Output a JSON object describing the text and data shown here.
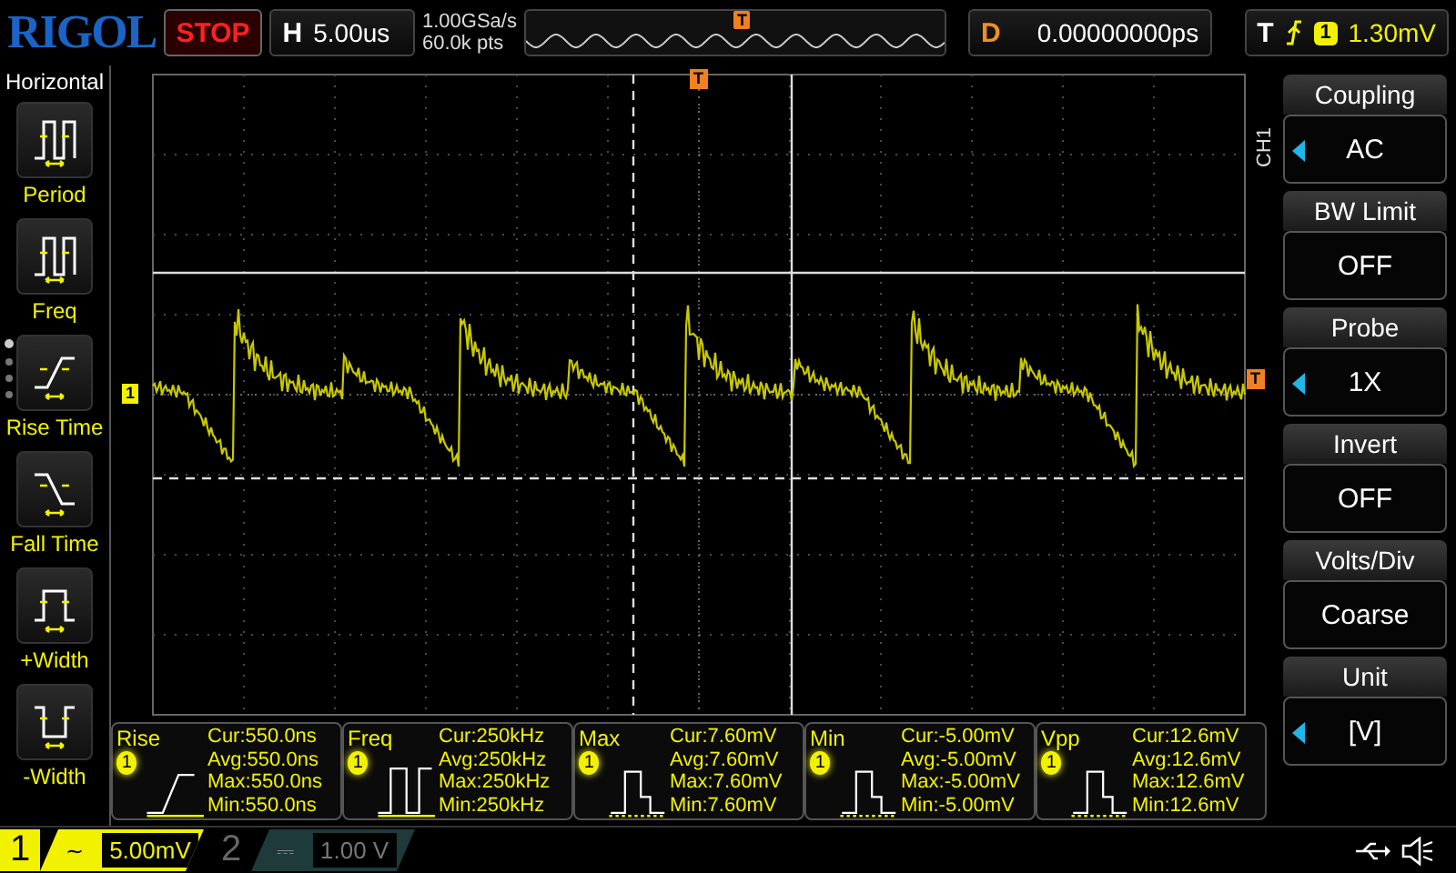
{
  "top_bar": {
    "logo": "RIGOL",
    "run_state": "STOP",
    "timebase": {
      "label": "H",
      "value": "5.00us"
    },
    "sample_rate": "1.00GSa/s",
    "memory_depth": "60.0k pts",
    "memory_marker": "T",
    "delay": {
      "label": "D",
      "value": "0.00000000ps"
    },
    "trigger": {
      "label": "T",
      "source": "1",
      "level": "1.30mV"
    }
  },
  "sidebar": {
    "title": "Horizontal",
    "items": [
      {
        "kind": "period",
        "label": "Period"
      },
      {
        "kind": "freq",
        "label": "Freq"
      },
      {
        "kind": "rise",
        "label": "Rise Time"
      },
      {
        "kind": "fall",
        "label": "Fall Time"
      },
      {
        "kind": "pwidth",
        "label": "+Width"
      },
      {
        "kind": "nwidth",
        "label": "-Width"
      }
    ]
  },
  "screen": {
    "channel_marker": "1",
    "trigger_marker_top": "T",
    "trigger_marker_right": "T",
    "channel_tag": "CH1"
  },
  "measurements": [
    {
      "kind": "rise",
      "title": "Rise",
      "channel": "1",
      "readings": [
        "Cur:550.0ns",
        "Avg:550.0ns",
        "Max:550.0ns",
        "Min:550.0ns"
      ]
    },
    {
      "kind": "freq",
      "title": "Freq",
      "channel": "1",
      "readings": [
        "Cur:250kHz",
        "Avg:250kHz",
        "Max:250kHz",
        "Min:250kHz"
      ]
    },
    {
      "kind": "max",
      "title": "Max",
      "channel": "1",
      "readings": [
        "Cur:7.60mV",
        "Avg:7.60mV",
        "Max:7.60mV",
        "Min:7.60mV"
      ]
    },
    {
      "kind": "min",
      "title": "Min",
      "channel": "1",
      "readings": [
        "Cur:-5.00mV",
        "Avg:-5.00mV",
        "Max:-5.00mV",
        "Min:-5.00mV"
      ]
    },
    {
      "kind": "vpp",
      "title": "Vpp",
      "channel": "1",
      "readings": [
        "Cur:12.6mV",
        "Avg:12.6mV",
        "Max:12.6mV",
        "Min:12.6mV"
      ]
    }
  ],
  "channel_menu": [
    {
      "title": "Coupling",
      "value": "AC",
      "adjustable": true
    },
    {
      "title": "BW Limit",
      "value": "OFF",
      "adjustable": false
    },
    {
      "title": "Probe",
      "value": "1X",
      "adjustable": true
    },
    {
      "title": "Invert",
      "value": "OFF",
      "adjustable": false
    },
    {
      "title": "Volts/Div",
      "value": "Coarse",
      "adjustable": false
    },
    {
      "title": "Unit",
      "value": "[V]",
      "adjustable": true
    }
  ],
  "status_bar": {
    "channels": [
      {
        "number": "1",
        "coupling": "~",
        "scale": "5.00mV",
        "active": true
      },
      {
        "number": "2",
        "coupling": "⎓",
        "scale": "1.00 V",
        "active": false
      }
    ]
  }
}
